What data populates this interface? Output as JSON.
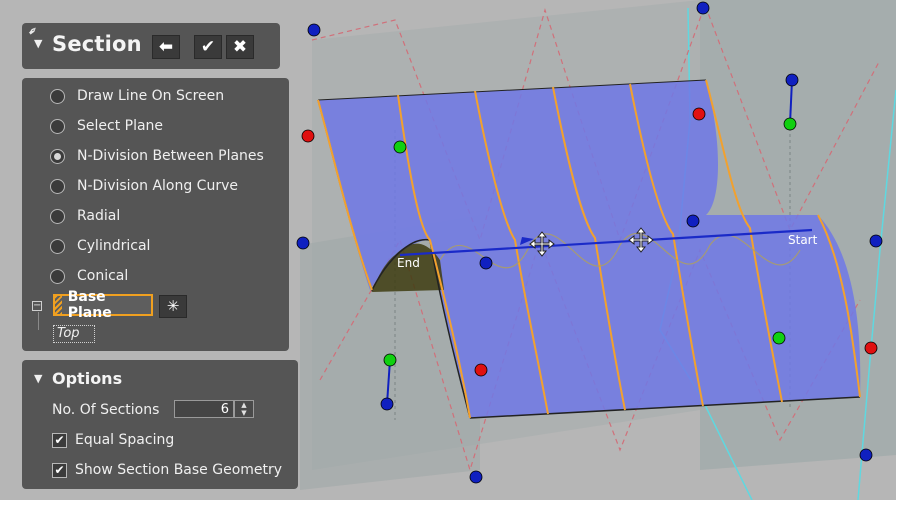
{
  "panel": {
    "title": "Section",
    "icons": {
      "pin": "pin-icon",
      "collapse": "triangle-down-icon",
      "back": "arrow-left-icon",
      "ok": "check-icon",
      "cancel": "close-icon"
    }
  },
  "methods": {
    "items": [
      {
        "label": "Draw Line On Screen",
        "selected": false
      },
      {
        "label": "Select Plane",
        "selected": false
      },
      {
        "label": "N-Division Between Planes",
        "selected": true
      },
      {
        "label": "N-Division Along Curve",
        "selected": false
      },
      {
        "label": "Radial",
        "selected": false
      },
      {
        "label": "Cylindrical",
        "selected": false
      },
      {
        "label": "Conical",
        "selected": false
      }
    ],
    "base_plane": {
      "label": "Base Plane",
      "value": "Top",
      "icon": "asterisk-icon",
      "accent": "#f0a020"
    }
  },
  "options": {
    "title": "Options",
    "sections_label": "No. Of Sections",
    "sections_value": "6",
    "equal_spacing": {
      "label": "Equal Spacing",
      "checked": true
    },
    "show_geometry": {
      "label": "Show Section Base Geometry",
      "checked": true
    }
  },
  "viewport": {
    "start_label": "Start",
    "end_label": "End",
    "colors": {
      "surface": "#6f78e6",
      "edge": "#f2a12e",
      "plane": "#8e9a9a",
      "handle_blue": "#1020c0",
      "handle_red": "#e01010",
      "handle_green": "#10d010",
      "axis_line": "#1a2ac8"
    }
  }
}
